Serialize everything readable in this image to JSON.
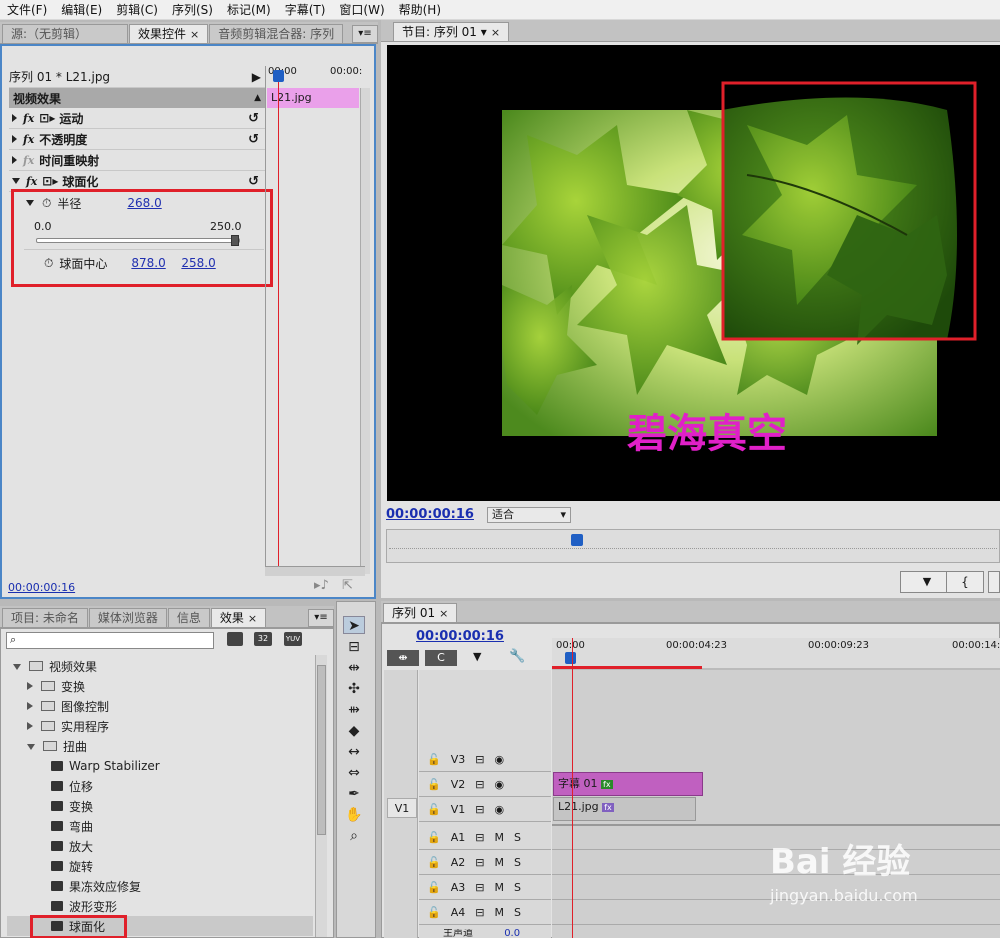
{
  "menu": [
    "文件(F)",
    "编辑(E)",
    "剪辑(C)",
    "序列(S)",
    "标记(M)",
    "字幕(T)",
    "窗口(W)",
    "帮助(H)"
  ],
  "top_left_tabs": {
    "source": "源:（无剪辑）",
    "effect_controls": "效果控件",
    "audio_mixer": "音频剪辑混合器: 序列",
    "close": "×",
    "menu": "▾≡"
  },
  "effect_controls": {
    "clip": "序列 01 * L21.jpg",
    "ruler_start": "00:00",
    "ruler_end": "00:00:",
    "clip_bar": "L21.jpg",
    "section": "视频效果",
    "effects": [
      "运动",
      "不透明度",
      "时间重映射",
      "球面化"
    ],
    "radius_label": "半径",
    "radius_value": "268.0",
    "slider_min": "0.0",
    "slider_max": "250.0",
    "slider_level": 1.0,
    "center_label": "球面中心",
    "center_x": "878.0",
    "center_y": "258.0",
    "timecode": "00:00:00:16"
  },
  "program": {
    "tab": "节目: 序列 01",
    "timecode": "00:00:00:16",
    "fit": "适合",
    "caption": "碧海真空",
    "caption_color": "#e020c8",
    "playhead_fraction": 0.31
  },
  "project_tabs": [
    "项目: 未命名",
    "媒体浏览器",
    "信息",
    "效果"
  ],
  "project": {
    "search_placeholder": "",
    "badges": [
      "32",
      "YUV"
    ],
    "tree": [
      {
        "label": "视频效果",
        "level": 0,
        "open": true
      },
      {
        "label": "变换",
        "level": 1,
        "open": false
      },
      {
        "label": "图像控制",
        "level": 1,
        "open": false
      },
      {
        "label": "实用程序",
        "level": 1,
        "open": false
      },
      {
        "label": "扭曲",
        "level": 1,
        "open": true
      },
      {
        "label": "Warp Stabilizer",
        "level": 2
      },
      {
        "label": "位移",
        "level": 2
      },
      {
        "label": "变换",
        "level": 2
      },
      {
        "label": "弯曲",
        "level": 2
      },
      {
        "label": "放大",
        "level": 2
      },
      {
        "label": "旋转",
        "level": 2
      },
      {
        "label": "果冻效应修复",
        "level": 2
      },
      {
        "label": "波形变形",
        "level": 2
      },
      {
        "label": "球面化",
        "level": 2
      }
    ]
  },
  "timeline": {
    "tab": "序列 01",
    "timecode": "00:00:00:16",
    "ruler": [
      "00:00",
      "00:00:04:23",
      "00:00:09:23",
      "00:00:14:"
    ],
    "video_tracks": [
      "V3",
      "V2",
      "V1"
    ],
    "source_patch": "V1",
    "audio_tracks": [
      "A1",
      "A2",
      "A3",
      "A4"
    ],
    "clip_title": "字幕 01",
    "clip_image": "L21.jpg",
    "master": "主声道",
    "master_value": "0.0",
    "mute": "M",
    "solo": "S"
  },
  "watermark": {
    "brand": "Bai 经验",
    "url": "jingyan.baidu.com"
  },
  "colors": {
    "accent_blue": "#4b86c7",
    "highlight_red": "#e0202a",
    "clip_title": "#c060c0",
    "clip_image": "#c4c4c4",
    "timecode_blue": "#1a2fb0"
  }
}
